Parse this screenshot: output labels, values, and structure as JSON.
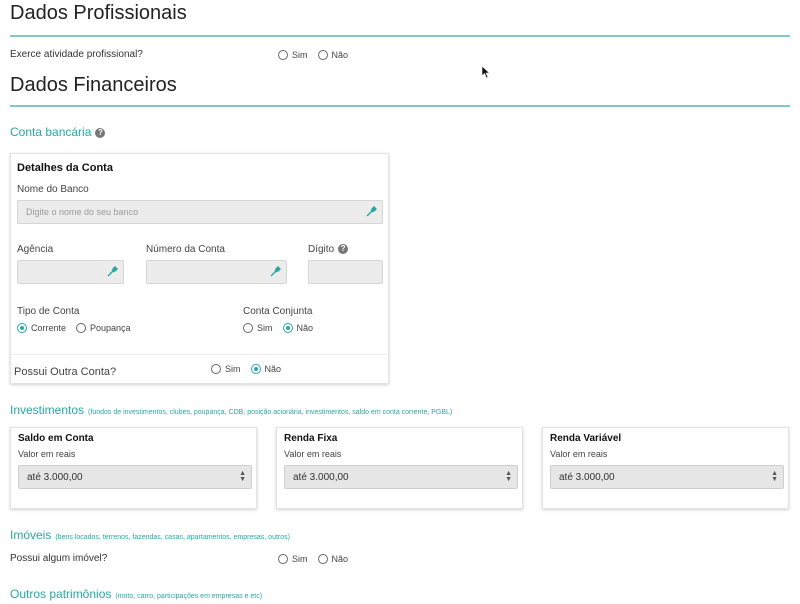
{
  "profissionais": {
    "title": "Dados Profissionais",
    "question": "Exerce atividade profissional?",
    "options": [
      "Sim",
      "Não"
    ]
  },
  "financeiros": {
    "title": "Dados Financeiros",
    "conta_bancaria": {
      "title": "Conta bancária",
      "card_title": "Detalhes da Conta",
      "banco_label": "Nome do Banco",
      "banco_placeholder": "Digite o nome do seu banco",
      "agencia_label": "Agência",
      "numero_label": "Número da Conta",
      "digito_label": "Dígito",
      "tipo_label": "Tipo de Conta",
      "tipo_options": [
        "Corrente",
        "Poupança"
      ],
      "tipo_selected": "Corrente",
      "conjunta_label": "Conta Conjunta",
      "conjunta_options": [
        "Sim",
        "Não"
      ],
      "conjunta_selected": "Não",
      "outra_label": "Possui Outra Conta?",
      "outra_options": [
        "Sim",
        "Não"
      ],
      "outra_selected": "Não"
    },
    "investimentos": {
      "title": "Investimentos",
      "note": "(fundos de investimentos, clubes, poupança, CDB, posição acionária, investimentos, saldo em conta corrente, PGBL)",
      "cards": [
        {
          "title": "Saldo em Conta",
          "label": "Valor em reais",
          "value": "até 3.000,00"
        },
        {
          "title": "Renda Fixa",
          "label": "Valor em reais",
          "value": "até 3.000,00"
        },
        {
          "title": "Renda Variável",
          "label": "Valor em reais",
          "value": "até 3.000,00"
        }
      ]
    },
    "imoveis": {
      "title": "Imóveis",
      "note": "(bens locados, terrenos, fazendas, casas, apartamentos, empresas, outros)",
      "question": "Possui algum imóvel?",
      "options": [
        "Sim",
        "Não"
      ]
    },
    "outros": {
      "title": "Outros patrimônios",
      "note": "(moto, carro, participações em empresas e etc)"
    }
  },
  "colors": {
    "accent": "#2aa7a2",
    "rule": "#7fc8c6"
  },
  "icons": {
    "help": "help-icon",
    "picker": "eyedropper-icon",
    "cursor": "mouse-cursor-icon"
  }
}
